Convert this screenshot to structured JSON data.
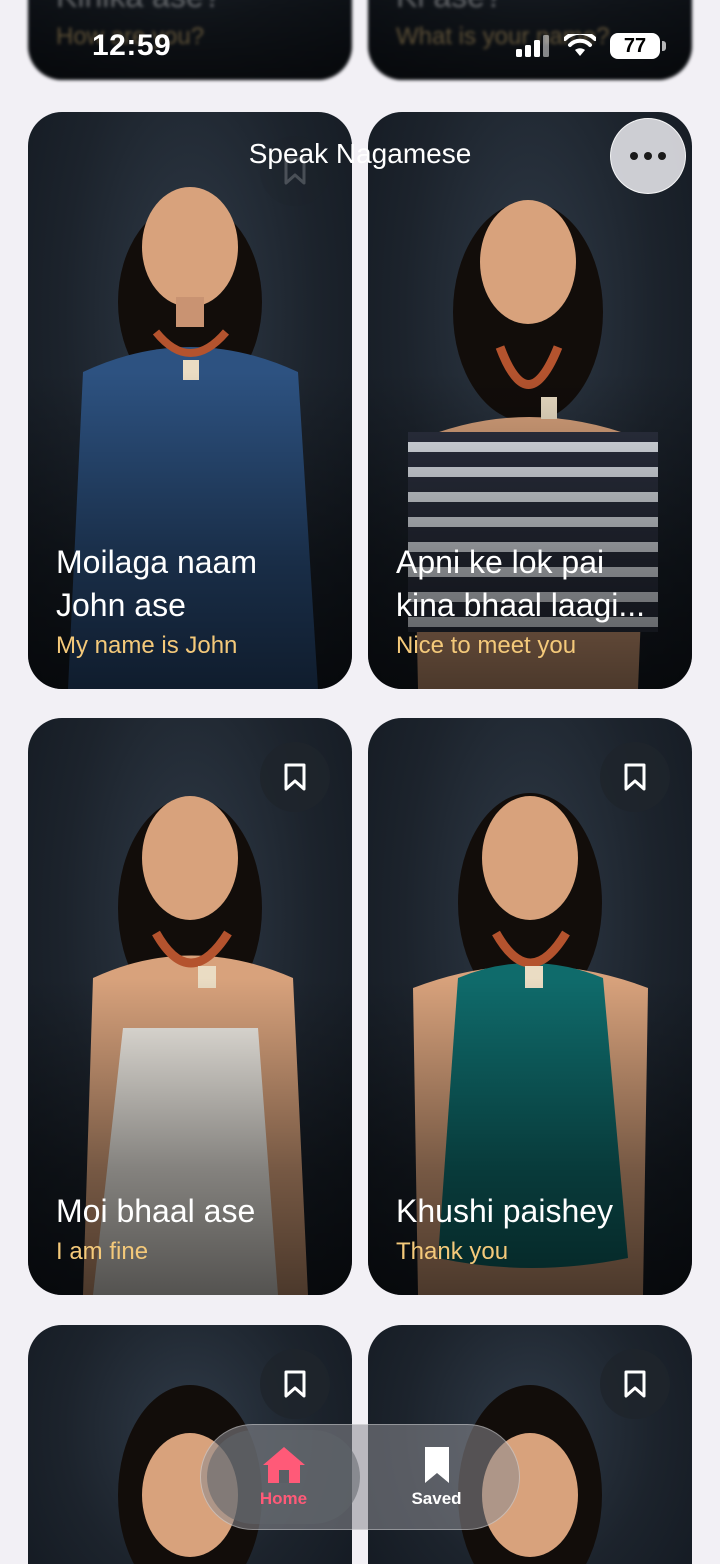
{
  "status_bar": {
    "time": "12:59",
    "battery": "77"
  },
  "nav": {
    "title": "Speak Nagamese"
  },
  "cards": [
    {
      "phrase": "Kinika ase?",
      "translation": "How are you?"
    },
    {
      "phrase": "Ki ase?",
      "translation": "What is your name?"
    },
    {
      "phrase": "Moilaga naam John ase",
      "translation": "My name is John"
    },
    {
      "phrase": "Apni ke lok pai kina bhaal laagi...",
      "translation": "Nice to meet you"
    },
    {
      "phrase": "Moi bhaal ase",
      "translation": "I am fine"
    },
    {
      "phrase": "Khushi paishey",
      "translation": "Thank you"
    }
  ],
  "tabbar": {
    "home_label": "Home",
    "saved_label": "Saved"
  },
  "colors": {
    "accent": "#ff5a78",
    "translation": "#f4c97a",
    "background": "#f2f0f5"
  }
}
